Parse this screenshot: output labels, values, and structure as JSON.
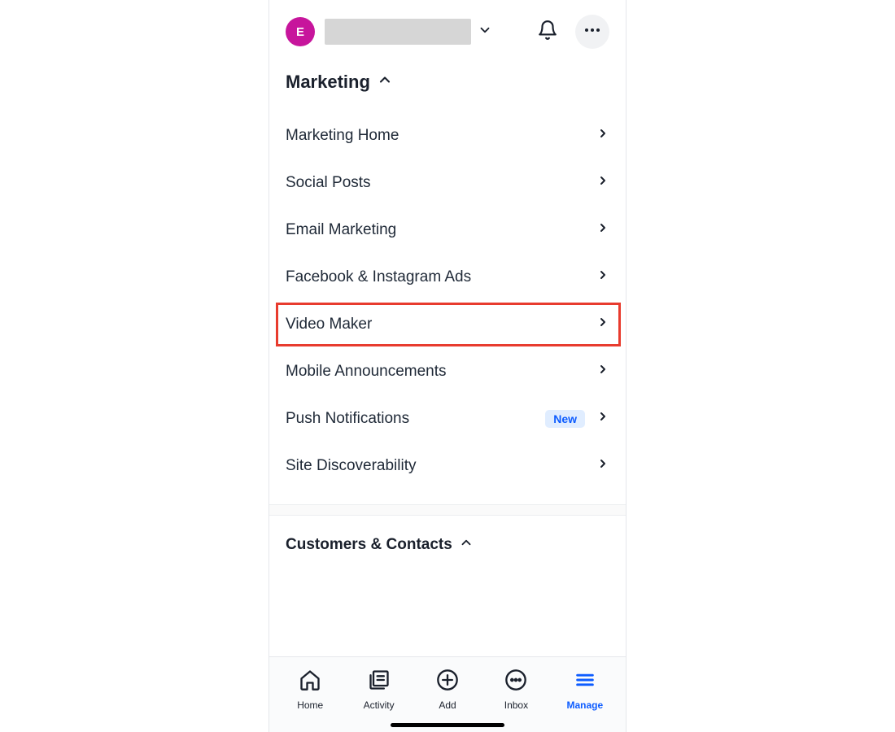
{
  "header": {
    "avatar_initial": "E"
  },
  "sections": {
    "marketing": {
      "title": "Marketing",
      "items": [
        {
          "label": "Marketing Home"
        },
        {
          "label": "Social Posts"
        },
        {
          "label": "Email Marketing"
        },
        {
          "label": "Facebook & Instagram Ads"
        },
        {
          "label": "Video Maker"
        },
        {
          "label": "Mobile Announcements"
        },
        {
          "label": "Push Notifications",
          "badge": "New"
        },
        {
          "label": "Site Discoverability"
        }
      ]
    },
    "customers": {
      "title": "Customers & Contacts"
    }
  },
  "bottom_nav": {
    "items": [
      {
        "label": "Home"
      },
      {
        "label": "Activity"
      },
      {
        "label": "Add"
      },
      {
        "label": "Inbox"
      },
      {
        "label": "Manage"
      }
    ]
  }
}
